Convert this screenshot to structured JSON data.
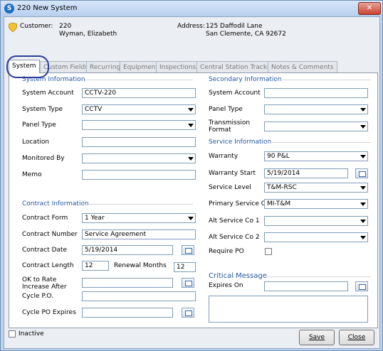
{
  "window": {
    "title": "220 New System",
    "app_icon": "S"
  },
  "header": {
    "customer_label": "Customer:",
    "customer_id": "220",
    "customer_name": "Wyman, Elizabeth",
    "address_label": "Address:",
    "address_line1": "125 Daffodil Lane",
    "address_line2": "San Clemente, CA  92672"
  },
  "tabs": [
    "System",
    "Custom Fields",
    "Recurring",
    "Equipment",
    "Inspections",
    "Central Station Tracking",
    "Notes & Comments"
  ],
  "system_info": {
    "heading": "System Information",
    "system_account_label": "System Account",
    "system_account_value": "CCTV-220",
    "system_type_label": "System Type",
    "system_type_value": "CCTV",
    "panel_type_label": "Panel Type",
    "panel_type_value": "",
    "location_label": "Location",
    "location_value": "",
    "monitored_by_label": "Monitored By",
    "monitored_by_value": "",
    "memo_label": "Memo",
    "memo_value": ""
  },
  "contract_info": {
    "heading": "Contract Information",
    "contract_form_label": "Contract Form",
    "contract_form_value": "1 Year",
    "contract_number_label": "Contract Number",
    "contract_number_value": "Service Agreement",
    "contract_date_label": "Contract Date",
    "contract_date_value": "5/19/2014",
    "contract_length_label": "Contract Length",
    "contract_length_value": "12",
    "renewal_months_label": "Renewal Months",
    "renewal_months_value": "12",
    "ok_to_rate_label": "OK to Rate Increase After",
    "ok_to_rate_value": "",
    "cycle_po_label": "Cycle P.O.",
    "cycle_po_value": "",
    "cycle_po_expires_label": "Cycle PO Expires",
    "cycle_po_expires_value": ""
  },
  "secondary_info": {
    "heading": "Secondary Information",
    "system_account_label": "System Account",
    "system_account_value": "",
    "panel_type_label": "Panel Type",
    "panel_type_value": "",
    "transmission_format_label": "Transmission Format",
    "transmission_format_value": ""
  },
  "service_info": {
    "heading": "Service Information",
    "warranty_label": "Warranty",
    "warranty_value": "90 P&L",
    "warranty_start_label": "Warranty Start",
    "warranty_start_value": "5/19/2014",
    "service_level_label": "Service Level",
    "service_level_value": "T&M-RSC",
    "primary_service_co_label": "Primary Service Co",
    "primary_service_co_value": "MI-T&M",
    "alt_service_co_1_label": "Alt Service Co 1",
    "alt_service_co_1_value": "",
    "alt_service_co_2_label": "Alt Service Co 2",
    "alt_service_co_2_value": "",
    "require_po_label": "Require PO"
  },
  "critical_message": {
    "heading": "Critical Message",
    "expires_on_label": "Expires On",
    "expires_on_value": "",
    "message_value": ""
  },
  "footer": {
    "inactive_label": "Inactive",
    "save_label": "Save",
    "close_label": "Close"
  },
  "icons": {
    "app": "app-icon",
    "customer": "shield-icon",
    "calendar": "calendar-icon",
    "dropdown": "chevron-down-icon"
  },
  "colors": {
    "section_heading": "#2356a8",
    "close_button": "#c9442f",
    "tab_highlight": "#2c3e9a"
  }
}
